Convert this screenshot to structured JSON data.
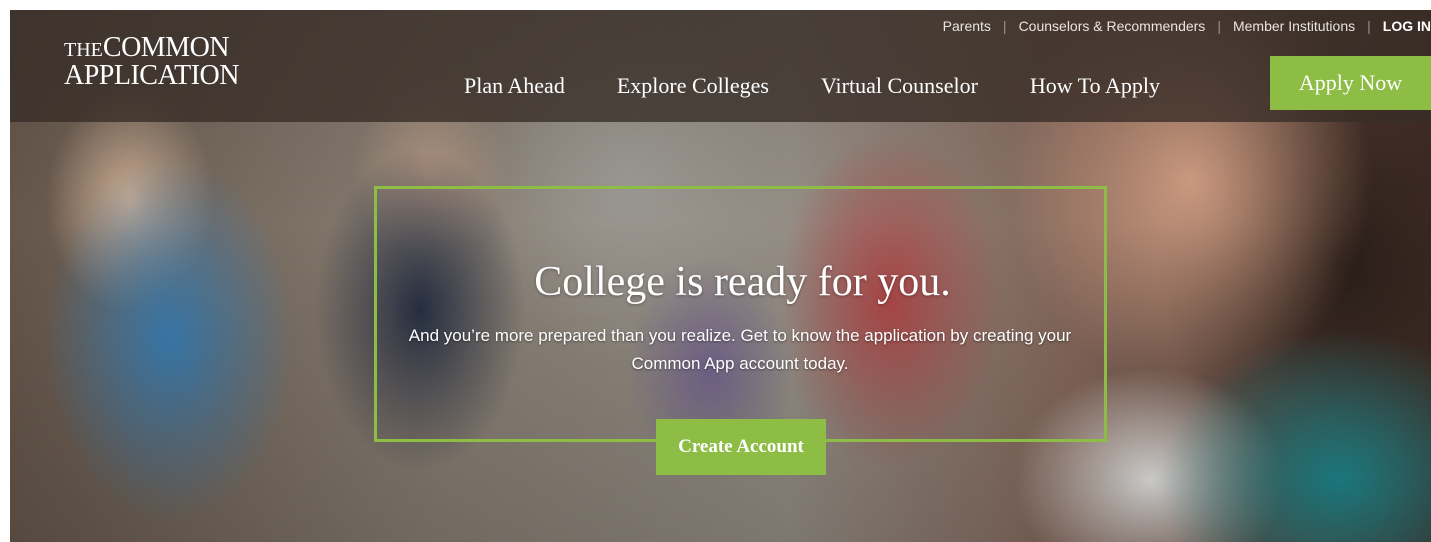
{
  "logo": {
    "the": "THE",
    "common": "COMMON",
    "application": "APPLICATION"
  },
  "utility_nav": {
    "items": [
      "Parents",
      "Counselors & Recommenders",
      "Member Institutions"
    ],
    "login": "LOG IN"
  },
  "main_nav": {
    "items": [
      "Plan Ahead",
      "Explore Colleges",
      "Virtual Counselor",
      "How To Apply"
    ],
    "apply_button": "Apply Now"
  },
  "hero": {
    "headline": "College is ready for you.",
    "subtext": "And you’re more prepared than you realize. Get to know the application by creating your Common App account today.",
    "cta": "Create Account"
  },
  "colors": {
    "accent_green": "#8dbd44",
    "header_bg": "#372d26"
  }
}
